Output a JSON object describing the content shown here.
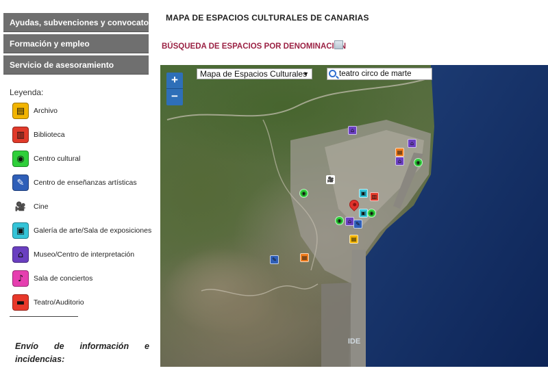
{
  "sidebar": {
    "nav": [
      {
        "label": "Ayudas, subvenciones y convocatorias"
      },
      {
        "label": "Formación y empleo"
      },
      {
        "label": "Servicio de asesoramiento"
      }
    ],
    "legend_title": "Leyenda:",
    "legend": [
      {
        "label": "Archivo",
        "color": "#f2b400",
        "icon": "archive-icon"
      },
      {
        "label": "Biblioteca",
        "color": "#e13a2a",
        "icon": "book-icon"
      },
      {
        "label": "Centro cultural",
        "color": "#2fcf3a",
        "icon": "target-icon"
      },
      {
        "label": "Centro de enseñanzas artísticas",
        "color": "#2f5fb8",
        "icon": "brush-icon"
      },
      {
        "label": "Cine",
        "color": "#ffffff",
        "icon": "film-camera-icon"
      },
      {
        "label": "Galería de arte/Sala de exposiciones",
        "color": "#34c4d8",
        "icon": "picture-icon"
      },
      {
        "label": "Museo/Centro de interpretación",
        "color": "#6a3fc0",
        "icon": "museum-icon"
      },
      {
        "label": "Sala de conciertos",
        "color": "#e63fb0",
        "icon": "music-note-icon"
      },
      {
        "label": "Teatro/Auditorio",
        "color": "#e8382a",
        "icon": "stage-icon"
      }
    ],
    "separator": "_________________",
    "envio": "Envío de información e incidencias:"
  },
  "main": {
    "title": "MAPA DE ESPACIOS CULTURALES DE CANARIAS",
    "search_heading": "BÚSQUEDA DE ESPACIOS POR DENOMINACIÓN"
  },
  "map": {
    "zoom_in": "+",
    "zoom_out": "−",
    "layer_select": "Mapa de Espacios Culturales",
    "search_value": "teatro circo de marte"
  }
}
